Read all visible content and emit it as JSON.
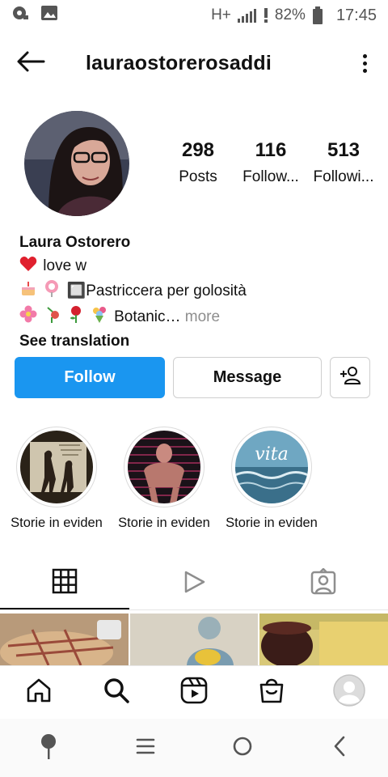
{
  "status_bar": {
    "network": "H+",
    "battery": "82%",
    "time": "17:45"
  },
  "header": {
    "username": "lauraostorerosaddi"
  },
  "profile": {
    "stats": [
      {
        "value": "298",
        "label": "Posts"
      },
      {
        "value": "116",
        "label": "Follow..."
      },
      {
        "value": "513",
        "label": "Followi..."
      }
    ],
    "name": "Laura Ostorero",
    "bio_line1": "love w",
    "bio_line2": "🔲Pastriccera per golosità",
    "bio_line3": "Botanic…",
    "more": "more",
    "see_translation": "See translation"
  },
  "actions": {
    "follow": "Follow",
    "message": "Message"
  },
  "highlights": [
    {
      "label": "Storie in eviden"
    },
    {
      "label": "Storie in eviden"
    },
    {
      "label": "Storie in eviden",
      "overlay_text": "vita"
    }
  ],
  "colors": {
    "follow_button": "#1a96f0",
    "muted_text": "#8e8e8e"
  }
}
